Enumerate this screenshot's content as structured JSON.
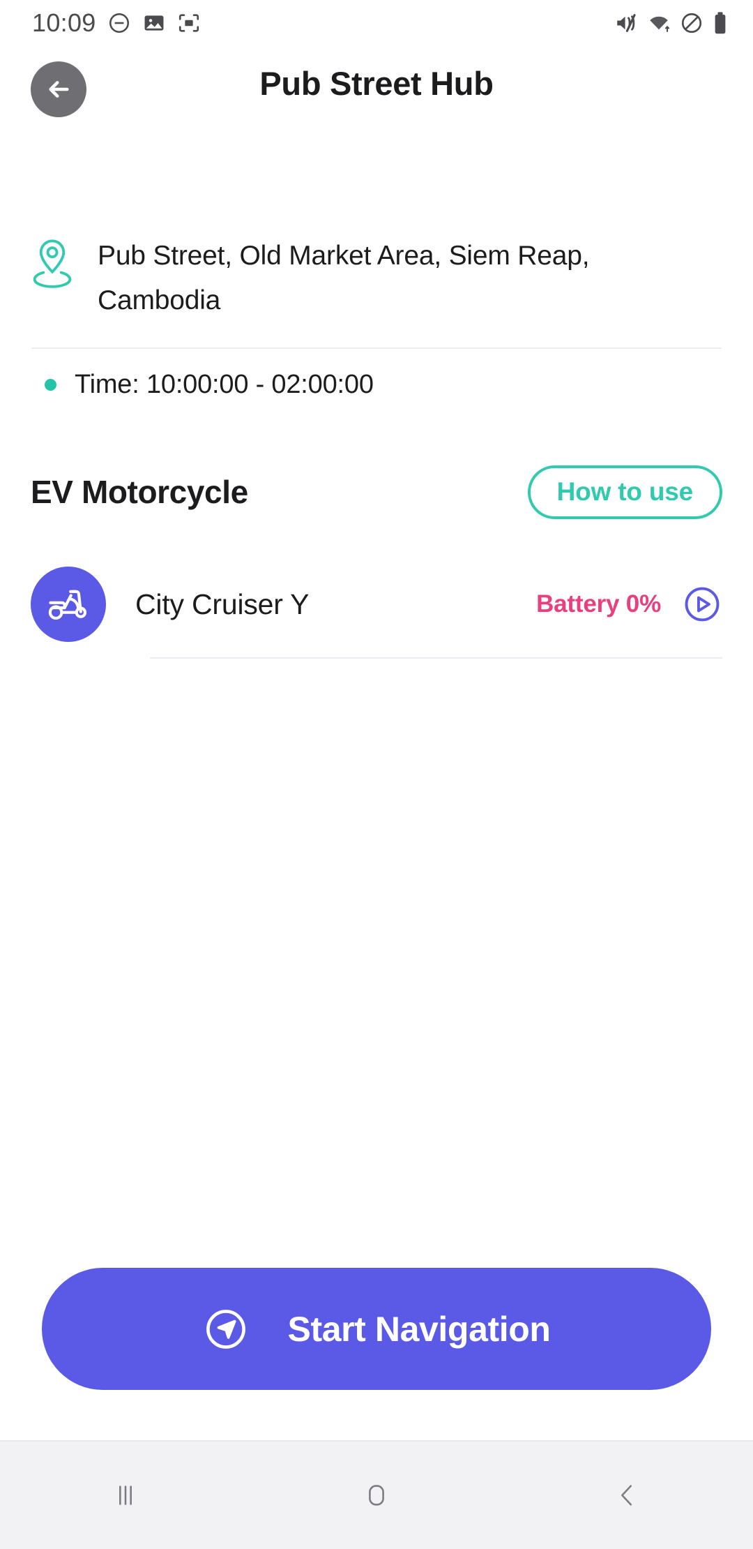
{
  "status_bar": {
    "time": "10:09",
    "left_icons": [
      "dnd-minus-icon",
      "image-icon",
      "screenshot-icon"
    ],
    "right_icons": [
      "volume-mute-icon",
      "wifi-icon",
      "block-icon",
      "battery-icon"
    ]
  },
  "header": {
    "back_icon": "arrow-left-icon",
    "title": "Pub Street Hub"
  },
  "location": {
    "pin_icon": "map-pin-icon",
    "address": "Pub Street, Old Market Area, Siem Reap, Cambodia",
    "time_label": "Time: 10:00:00 - 02:00:00"
  },
  "section": {
    "title": "EV Motorcycle",
    "how_to_use_label": "How to use"
  },
  "vehicles": [
    {
      "icon": "scooter-icon",
      "name": "City Cruiser Y",
      "battery": "Battery 0%",
      "play_icon": "play-circle-icon"
    }
  ],
  "footer": {
    "start_nav_label": "Start Navigation",
    "start_nav_icon": "navigation-arrow-icon"
  },
  "nav_bar": {
    "recents_label": "recents-icon",
    "home_label": "home-icon",
    "back_label": "back-icon"
  },
  "colors": {
    "accent_teal": "#2fcab0",
    "accent_purple": "#5a5ae6",
    "battery_pink": "#ea3f7e",
    "text_dark": "#1c1c1e",
    "divider": "#ececf0"
  }
}
